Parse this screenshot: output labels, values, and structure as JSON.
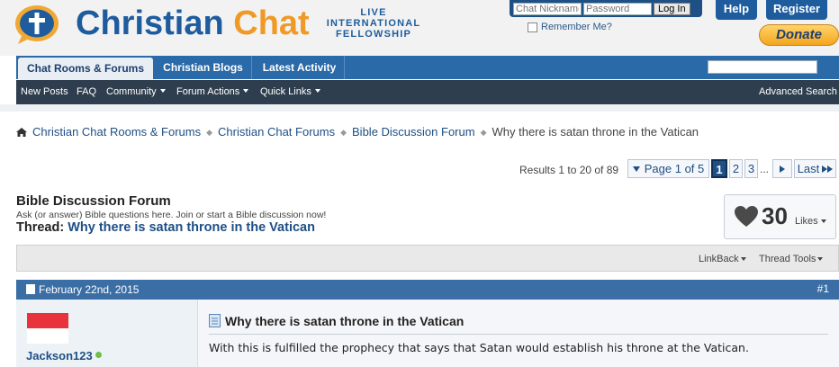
{
  "header": {
    "logo_word1": "Christian",
    "logo_word2": "Chat",
    "tagline": [
      "LIVE",
      "INTERNATIONAL",
      "FELLOWSHIP"
    ],
    "nickname_placeholder": "Chat Nickname",
    "password_placeholder": "Password",
    "login_label": "Log In",
    "remember_label": "Remember Me?",
    "help_label": "Help",
    "register_label": "Register",
    "donate_label": "Donate"
  },
  "tabs": [
    {
      "label": "Chat Rooms & Forums",
      "active": true
    },
    {
      "label": "Christian Blogs"
    },
    {
      "label": "Latest Activity"
    }
  ],
  "subnav": {
    "new_posts": "New Posts",
    "faq": "FAQ",
    "community": "Community",
    "forum_actions": "Forum Actions",
    "quick_links": "Quick Links",
    "advanced_search": "Advanced Search"
  },
  "breadcrumb": [
    "Christian Chat Rooms & Forums",
    "Christian Chat Forums",
    "Bible Discussion Forum",
    "Why there is satan throne in the Vatican"
  ],
  "pagination": {
    "results": "Results 1 to 20 of 89",
    "page_of": "Page 1 of 5",
    "pages": [
      "1",
      "2",
      "3"
    ],
    "ellipsis": "...",
    "last": "Last"
  },
  "forum": {
    "title": "Bible Discussion Forum",
    "description": "Ask (or answer) Bible questions here. Join or start a Bible discussion now!",
    "thread_prefix": "Thread:",
    "thread_title": "Why there is satan throne in the Vatican",
    "likes_count": "30",
    "likes_label": "Likes"
  },
  "toolbar": {
    "linkback": "LinkBack",
    "thread_tools": "Thread Tools"
  },
  "post": {
    "date": "February 22nd, 2015",
    "number": "#1",
    "username": "Jackson123",
    "title": "Why there is satan throne in the Vatican",
    "text": "With this is fulfilled the prophecy that says that Satan would establish his throne at the Vatican."
  },
  "colors": {
    "brand_blue": "#1e5c9e",
    "brand_orange": "#f09a26",
    "nav_blue": "#2b6aa8",
    "subnav_dark": "#2f3e4e",
    "post_header": "#3a6ea5"
  }
}
